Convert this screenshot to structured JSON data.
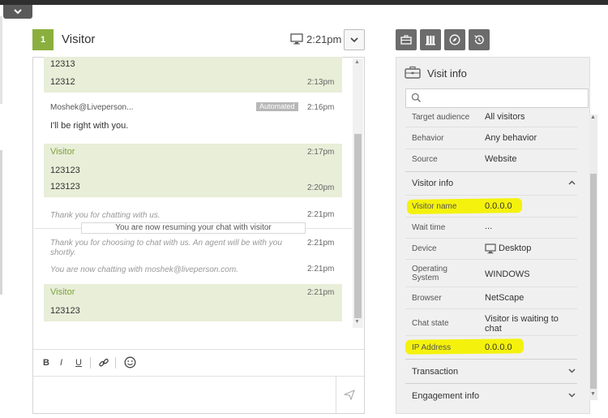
{
  "header": {
    "badge_number": "1",
    "visitor_title": "Visitor",
    "time": "2:21pm"
  },
  "chat": {
    "messages": [
      {
        "text": "12313",
        "time": ""
      },
      {
        "text": "12312",
        "time": "2:13pm"
      },
      {
        "sender": "Moshek@Liveperson...",
        "badge": "Automated",
        "time": "2:16pm",
        "text": "I'll be right with you."
      },
      {
        "sender": "Visitor",
        "time": "2:17pm"
      },
      {
        "text": "123123",
        "time": ""
      },
      {
        "text": "123123",
        "time": "2:20pm"
      },
      {
        "system": "Thank you for chatting with us.",
        "time": "2:21pm"
      },
      {
        "resume": "You are now resuming your chat with visitor"
      },
      {
        "system": "Thank you for choosing to chat with us. An agent will be with you shortly.",
        "time": "2:21pm"
      },
      {
        "system": "You are now chatting with moshek@liveperson.com.",
        "time": "2:21pm"
      },
      {
        "sender": "Visitor",
        "time": "2:21pm",
        "text": "123123"
      }
    ],
    "format_bar": {
      "bold": "B",
      "italic": "I",
      "underline": "U"
    }
  },
  "info_panel": {
    "title": "Visit info",
    "search_placeholder": "",
    "top_rows": [
      {
        "label": "Target audience",
        "value": "All visitors"
      },
      {
        "label": "Behavior",
        "value": "Any behavior"
      },
      {
        "label": "Source",
        "value": "Website"
      }
    ],
    "visitor_info": {
      "title": "Visitor info",
      "rows": [
        {
          "label": "Visitor name",
          "value": "0.0.0.0"
        },
        {
          "label": "Wait time",
          "value": "..."
        },
        {
          "label": "Device",
          "value": "Desktop"
        },
        {
          "label": "Operating System",
          "value": "WINDOWS"
        },
        {
          "label": "Browser",
          "value": "NetScape"
        },
        {
          "label": "Chat state",
          "value": "Visitor is waiting to chat"
        },
        {
          "label": "IP Address",
          "value": "0.0.0.0"
        }
      ]
    },
    "transaction": {
      "title": "Transaction"
    },
    "engagement": {
      "title": "Engagement info"
    }
  },
  "icons": [
    "chevron-down-icon",
    "monitor-icon",
    "briefcase-icon",
    "book-icon",
    "compass-icon",
    "history-icon",
    "search-icon",
    "link-icon",
    "smiley-icon",
    "send-icon"
  ],
  "colors": {
    "accent_green": "#8aaf3e",
    "visitor_bubble": "#e8eed8",
    "highlight_yellow": "#f4f20c"
  }
}
